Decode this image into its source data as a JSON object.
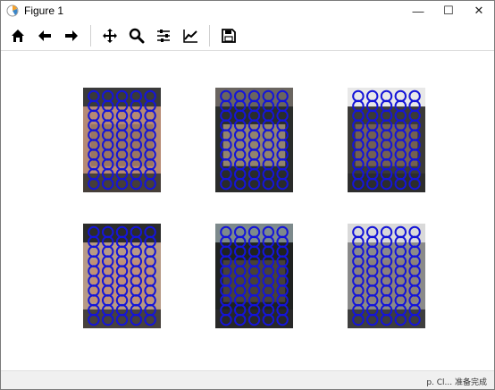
{
  "window": {
    "title": "Figure 1",
    "minimize_glyph": "—",
    "maximize_glyph": "☐",
    "close_glyph": "✕"
  },
  "toolbar": {
    "buttons": [
      {
        "name": "home-icon",
        "label": "Home"
      },
      {
        "name": "back-icon",
        "label": "Back"
      },
      {
        "name": "forward-icon",
        "label": "Forward"
      },
      {
        "name": "pan-icon",
        "label": "Pan"
      },
      {
        "name": "zoom-icon",
        "label": "Zoom"
      },
      {
        "name": "configure-subplots-icon",
        "label": "Configure subplots"
      },
      {
        "name": "edit-axis-icon",
        "label": "Edit axis"
      },
      {
        "name": "save-icon",
        "label": "Save"
      }
    ]
  },
  "figure": {
    "panels": [
      {
        "id": "image-1",
        "grid": [
          5,
          10
        ]
      },
      {
        "id": "image-2",
        "grid": [
          5,
          10
        ]
      },
      {
        "id": "image-3",
        "grid": [
          5,
          10
        ]
      },
      {
        "id": "image-4",
        "grid": [
          5,
          10
        ]
      },
      {
        "id": "image-5",
        "grid": [
          5,
          10
        ]
      },
      {
        "id": "image-6",
        "grid": [
          5,
          10
        ]
      }
    ],
    "circle_color": "#1515d8"
  },
  "taskbar": {
    "fragment": "p. Cl...   准备完成"
  }
}
